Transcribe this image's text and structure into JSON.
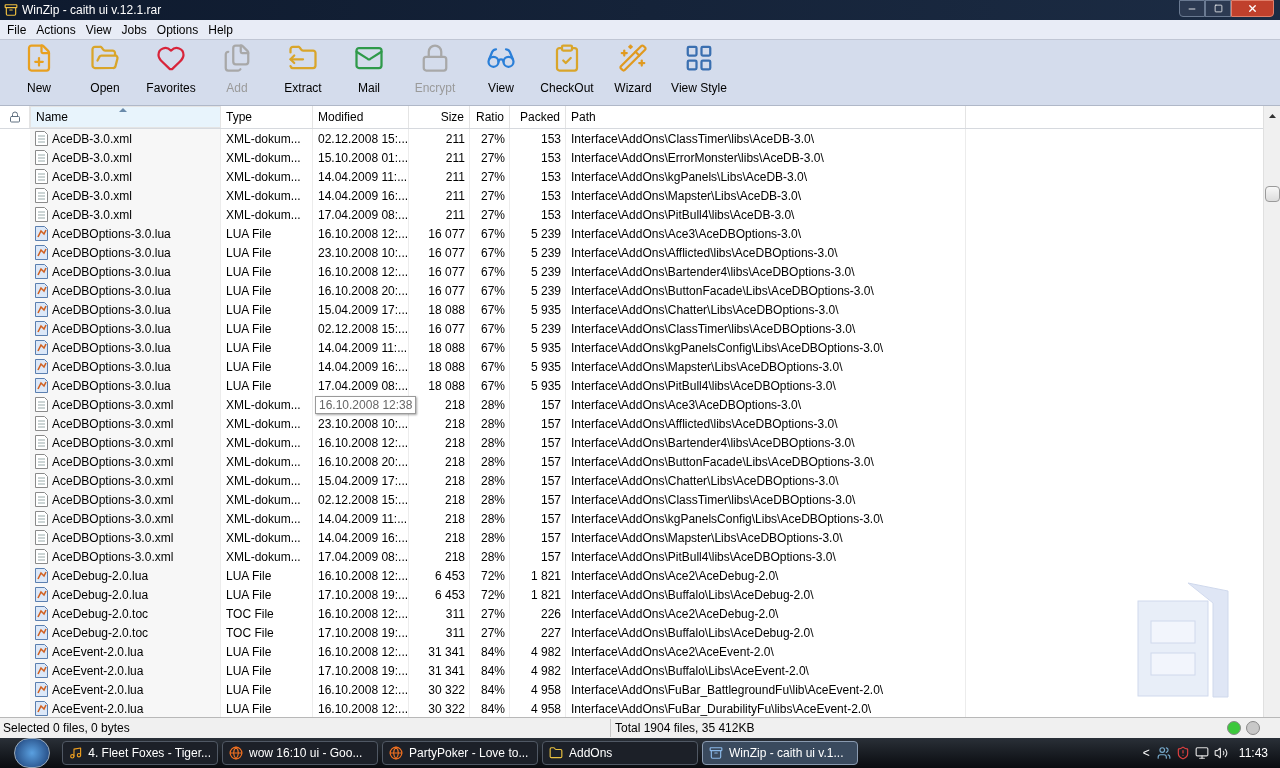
{
  "window": {
    "title": "WinZip - caith ui v.12.1.rar"
  },
  "menu": [
    "File",
    "Actions",
    "View",
    "Jobs",
    "Options",
    "Help"
  ],
  "toolbar": [
    {
      "label": "New",
      "kind": "new",
      "disabled": false
    },
    {
      "label": "Open",
      "kind": "open",
      "disabled": false
    },
    {
      "label": "Favorites",
      "kind": "favorites",
      "disabled": false
    },
    {
      "label": "Add",
      "kind": "add",
      "disabled": true
    },
    {
      "label": "Extract",
      "kind": "extract",
      "disabled": false
    },
    {
      "label": "Mail",
      "kind": "mail",
      "disabled": false
    },
    {
      "label": "Encrypt",
      "kind": "encrypt",
      "disabled": true
    },
    {
      "label": "View",
      "kind": "view",
      "disabled": false
    },
    {
      "label": "CheckOut",
      "kind": "checkout",
      "disabled": false
    },
    {
      "label": "Wizard",
      "kind": "wizard",
      "disabled": false
    },
    {
      "label": "View Style",
      "kind": "viewstyle",
      "disabled": false
    }
  ],
  "table": {
    "columns": [
      {
        "label": "Name",
        "selected": true
      },
      {
        "label": "Type",
        "selected": false
      },
      {
        "label": "Modified",
        "selected": false
      },
      {
        "label": "Size",
        "selected": false
      },
      {
        "label": "Ratio",
        "selected": false
      },
      {
        "label": "Packed",
        "selected": false
      },
      {
        "label": "Path",
        "selected": false
      }
    ],
    "rows": [
      {
        "kind": "xml",
        "tooltip": false,
        "cells": [
          "AceDB-3.0.xml",
          "XML-dokum...",
          "02.12.2008 15:...",
          "211",
          "27%",
          "153",
          "Interface\\AddOns\\ClassTimer\\libs\\AceDB-3.0\\"
        ]
      },
      {
        "kind": "xml",
        "tooltip": false,
        "cells": [
          "AceDB-3.0.xml",
          "XML-dokum...",
          "15.10.2008 01:...",
          "211",
          "27%",
          "153",
          "Interface\\AddOns\\ErrorMonster\\libs\\AceDB-3.0\\"
        ]
      },
      {
        "kind": "xml",
        "tooltip": false,
        "cells": [
          "AceDB-3.0.xml",
          "XML-dokum...",
          "14.04.2009 11:...",
          "211",
          "27%",
          "153",
          "Interface\\AddOns\\kgPanels\\Libs\\AceDB-3.0\\"
        ]
      },
      {
        "kind": "xml",
        "tooltip": false,
        "cells": [
          "AceDB-3.0.xml",
          "XML-dokum...",
          "14.04.2009 16:...",
          "211",
          "27%",
          "153",
          "Interface\\AddOns\\Mapster\\Libs\\AceDB-3.0\\"
        ]
      },
      {
        "kind": "xml",
        "tooltip": false,
        "cells": [
          "AceDB-3.0.xml",
          "XML-dokum...",
          "17.04.2009 08:...",
          "211",
          "27%",
          "153",
          "Interface\\AddOns\\PitBull4\\libs\\AceDB-3.0\\"
        ]
      },
      {
        "kind": "lua",
        "tooltip": false,
        "cells": [
          "AceDBOptions-3.0.lua",
          "LUA File",
          "16.10.2008 12:...",
          "16 077",
          "67%",
          "5 239",
          "Interface\\AddOns\\Ace3\\AceDBOptions-3.0\\"
        ]
      },
      {
        "kind": "lua",
        "tooltip": false,
        "cells": [
          "AceDBOptions-3.0.lua",
          "LUA File",
          "23.10.2008 10:...",
          "16 077",
          "67%",
          "5 239",
          "Interface\\AddOns\\Afflicted\\libs\\AceDBOptions-3.0\\"
        ]
      },
      {
        "kind": "lua",
        "tooltip": false,
        "cells": [
          "AceDBOptions-3.0.lua",
          "LUA File",
          "16.10.2008 12:...",
          "16 077",
          "67%",
          "5 239",
          "Interface\\AddOns\\Bartender4\\libs\\AceDBOptions-3.0\\"
        ]
      },
      {
        "kind": "lua",
        "tooltip": false,
        "cells": [
          "AceDBOptions-3.0.lua",
          "LUA File",
          "16.10.2008 20:...",
          "16 077",
          "67%",
          "5 239",
          "Interface\\AddOns\\ButtonFacade\\Libs\\AceDBOptions-3.0\\"
        ]
      },
      {
        "kind": "lua",
        "tooltip": false,
        "cells": [
          "AceDBOptions-3.0.lua",
          "LUA File",
          "15.04.2009 17:...",
          "18 088",
          "67%",
          "5 935",
          "Interface\\AddOns\\Chatter\\Libs\\AceDBOptions-3.0\\"
        ]
      },
      {
        "kind": "lua",
        "tooltip": false,
        "cells": [
          "AceDBOptions-3.0.lua",
          "LUA File",
          "02.12.2008 15:...",
          "16 077",
          "67%",
          "5 239",
          "Interface\\AddOns\\ClassTimer\\libs\\AceDBOptions-3.0\\"
        ]
      },
      {
        "kind": "lua",
        "tooltip": false,
        "cells": [
          "AceDBOptions-3.0.lua",
          "LUA File",
          "14.04.2009 11:...",
          "18 088",
          "67%",
          "5 935",
          "Interface\\AddOns\\kgPanelsConfig\\Libs\\AceDBOptions-3.0\\"
        ]
      },
      {
        "kind": "lua",
        "tooltip": false,
        "cells": [
          "AceDBOptions-3.0.lua",
          "LUA File",
          "14.04.2009 16:...",
          "18 088",
          "67%",
          "5 935",
          "Interface\\AddOns\\Mapster\\Libs\\AceDBOptions-3.0\\"
        ]
      },
      {
        "kind": "lua",
        "tooltip": false,
        "cells": [
          "AceDBOptions-3.0.lua",
          "LUA File",
          "17.04.2009 08:...",
          "18 088",
          "67%",
          "5 935",
          "Interface\\AddOns\\PitBull4\\libs\\AceDBOptions-3.0\\"
        ]
      },
      {
        "kind": "xml",
        "tooltip": true,
        "cells": [
          "AceDBOptions-3.0.xml",
          "XML-dokum...",
          "16.10.2008 12:38",
          "218",
          "28%",
          "157",
          "Interface\\AddOns\\Ace3\\AceDBOptions-3.0\\"
        ]
      },
      {
        "kind": "xml",
        "tooltip": false,
        "cells": [
          "AceDBOptions-3.0.xml",
          "XML-dokum...",
          "23.10.2008 10:...",
          "218",
          "28%",
          "157",
          "Interface\\AddOns\\Afflicted\\libs\\AceDBOptions-3.0\\"
        ]
      },
      {
        "kind": "xml",
        "tooltip": false,
        "cells": [
          "AceDBOptions-3.0.xml",
          "XML-dokum...",
          "16.10.2008 12:...",
          "218",
          "28%",
          "157",
          "Interface\\AddOns\\Bartender4\\libs\\AceDBOptions-3.0\\"
        ]
      },
      {
        "kind": "xml",
        "tooltip": false,
        "cells": [
          "AceDBOptions-3.0.xml",
          "XML-dokum...",
          "16.10.2008 20:...",
          "218",
          "28%",
          "157",
          "Interface\\AddOns\\ButtonFacade\\Libs\\AceDBOptions-3.0\\"
        ]
      },
      {
        "kind": "xml",
        "tooltip": false,
        "cells": [
          "AceDBOptions-3.0.xml",
          "XML-dokum...",
          "15.04.2009 17:...",
          "218",
          "28%",
          "157",
          "Interface\\AddOns\\Chatter\\Libs\\AceDBOptions-3.0\\"
        ]
      },
      {
        "kind": "xml",
        "tooltip": false,
        "cells": [
          "AceDBOptions-3.0.xml",
          "XML-dokum...",
          "02.12.2008 15:...",
          "218",
          "28%",
          "157",
          "Interface\\AddOns\\ClassTimer\\libs\\AceDBOptions-3.0\\"
        ]
      },
      {
        "kind": "xml",
        "tooltip": false,
        "cells": [
          "AceDBOptions-3.0.xml",
          "XML-dokum...",
          "14.04.2009 11:...",
          "218",
          "28%",
          "157",
          "Interface\\AddOns\\kgPanelsConfig\\Libs\\AceDBOptions-3.0\\"
        ]
      },
      {
        "kind": "xml",
        "tooltip": false,
        "cells": [
          "AceDBOptions-3.0.xml",
          "XML-dokum...",
          "14.04.2009 16:...",
          "218",
          "28%",
          "157",
          "Interface\\AddOns\\Mapster\\Libs\\AceDBOptions-3.0\\"
        ]
      },
      {
        "kind": "xml",
        "tooltip": false,
        "cells": [
          "AceDBOptions-3.0.xml",
          "XML-dokum...",
          "17.04.2009 08:...",
          "218",
          "28%",
          "157",
          "Interface\\AddOns\\PitBull4\\libs\\AceDBOptions-3.0\\"
        ]
      },
      {
        "kind": "lua",
        "tooltip": false,
        "cells": [
          "AceDebug-2.0.lua",
          "LUA File",
          "16.10.2008 12:...",
          "6 453",
          "72%",
          "1 821",
          "Interface\\AddOns\\Ace2\\AceDebug-2.0\\"
        ]
      },
      {
        "kind": "lua",
        "tooltip": false,
        "cells": [
          "AceDebug-2.0.lua",
          "LUA File",
          "17.10.2008 19:...",
          "6 453",
          "72%",
          "1 821",
          "Interface\\AddOns\\Buffalo\\Libs\\AceDebug-2.0\\"
        ]
      },
      {
        "kind": "lua",
        "tooltip": false,
        "cells": [
          "AceDebug-2.0.toc",
          "TOC File",
          "16.10.2008 12:...",
          "311",
          "27%",
          "226",
          "Interface\\AddOns\\Ace2\\AceDebug-2.0\\"
        ]
      },
      {
        "kind": "lua",
        "tooltip": false,
        "cells": [
          "AceDebug-2.0.toc",
          "TOC File",
          "17.10.2008 19:...",
          "311",
          "27%",
          "227",
          "Interface\\AddOns\\Buffalo\\Libs\\AceDebug-2.0\\"
        ]
      },
      {
        "kind": "lua",
        "tooltip": false,
        "cells": [
          "AceEvent-2.0.lua",
          "LUA File",
          "16.10.2008 12:...",
          "31 341",
          "84%",
          "4 982",
          "Interface\\AddOns\\Ace2\\AceEvent-2.0\\"
        ]
      },
      {
        "kind": "lua",
        "tooltip": false,
        "cells": [
          "AceEvent-2.0.lua",
          "LUA File",
          "17.10.2008 19:...",
          "31 341",
          "84%",
          "4 982",
          "Interface\\AddOns\\Buffalo\\Libs\\AceEvent-2.0\\"
        ]
      },
      {
        "kind": "lua",
        "tooltip": false,
        "cells": [
          "AceEvent-2.0.lua",
          "LUA File",
          "16.10.2008 12:...",
          "30 322",
          "84%",
          "4 958",
          "Interface\\AddOns\\FuBar_BattlegroundFu\\lib\\AceEvent-2.0\\"
        ]
      },
      {
        "kind": "lua",
        "tooltip": false,
        "cells": [
          "AceEvent-2.0.lua",
          "LUA File",
          "16.10.2008 12:...",
          "30 322",
          "84%",
          "4 958",
          "Interface\\AddOns\\FuBar_DurabilityFu\\libs\\AceEvent-2.0\\"
        ]
      }
    ]
  },
  "status_bar": {
    "left": "Selected 0 files, 0 bytes",
    "right": "Total 1904 files, 35 412KB",
    "lights": [
      {
        "color": "#3cc83c"
      },
      {
        "color": "#c8c8c8"
      }
    ]
  },
  "taskbar": {
    "items": [
      {
        "label": "4. Fleet Foxes - Tiger...",
        "kind": "media",
        "selected": false
      },
      {
        "label": "wow 16:10 ui - Goo...",
        "kind": "browser",
        "selected": false
      },
      {
        "label": "PartyPoker - Love to...",
        "kind": "browser",
        "selected": false
      },
      {
        "label": "AddOns",
        "kind": "folder",
        "selected": false
      },
      {
        "label": "WinZip - caith ui v.1...",
        "kind": "app",
        "selected": true
      }
    ],
    "tray_toggle": "<",
    "clock": "11:43"
  }
}
